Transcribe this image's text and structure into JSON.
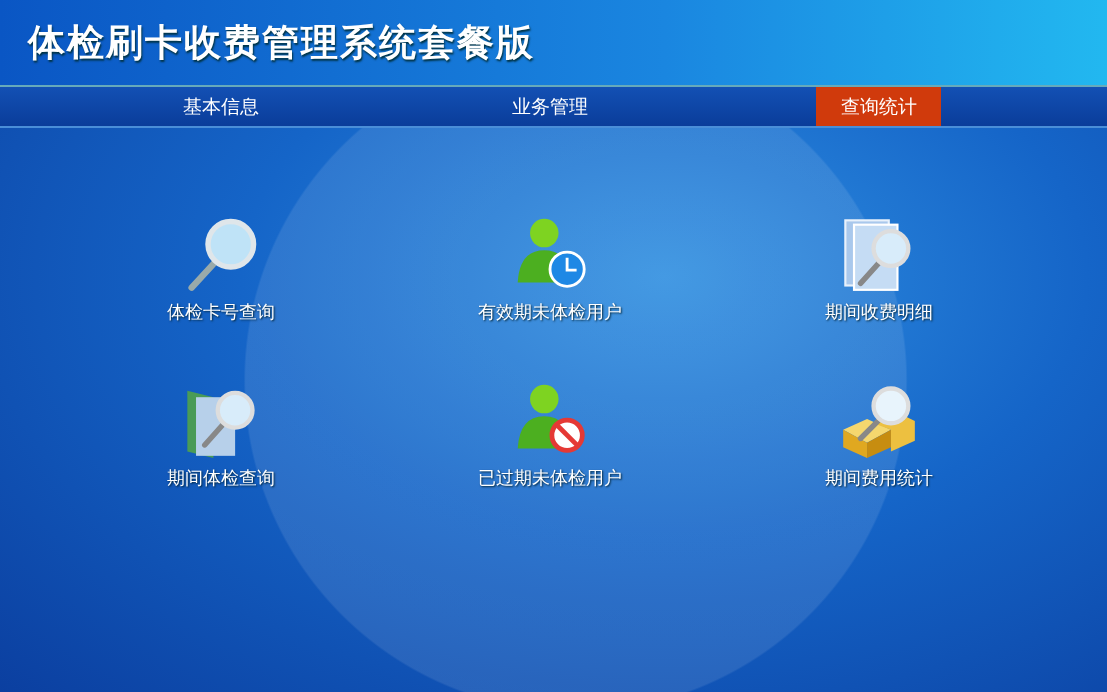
{
  "header": {
    "title": "体检刷卡收费管理系统套餐版"
  },
  "tabs": [
    {
      "label": "基本信息",
      "selected": false
    },
    {
      "label": "业务管理",
      "selected": false
    },
    {
      "label": "查询统计",
      "selected": true
    }
  ],
  "items": [
    {
      "label": "体检卡号查询",
      "kind": "magnifier"
    },
    {
      "label": "有效期未体检用户",
      "kind": "user-clock"
    },
    {
      "label": "期间收费明细",
      "kind": "documents"
    },
    {
      "label": "期间体检查询",
      "kind": "folder"
    },
    {
      "label": "已过期未体检用户",
      "kind": "user-forbidden"
    },
    {
      "label": "期间费用统计",
      "kind": "boxes"
    }
  ]
}
